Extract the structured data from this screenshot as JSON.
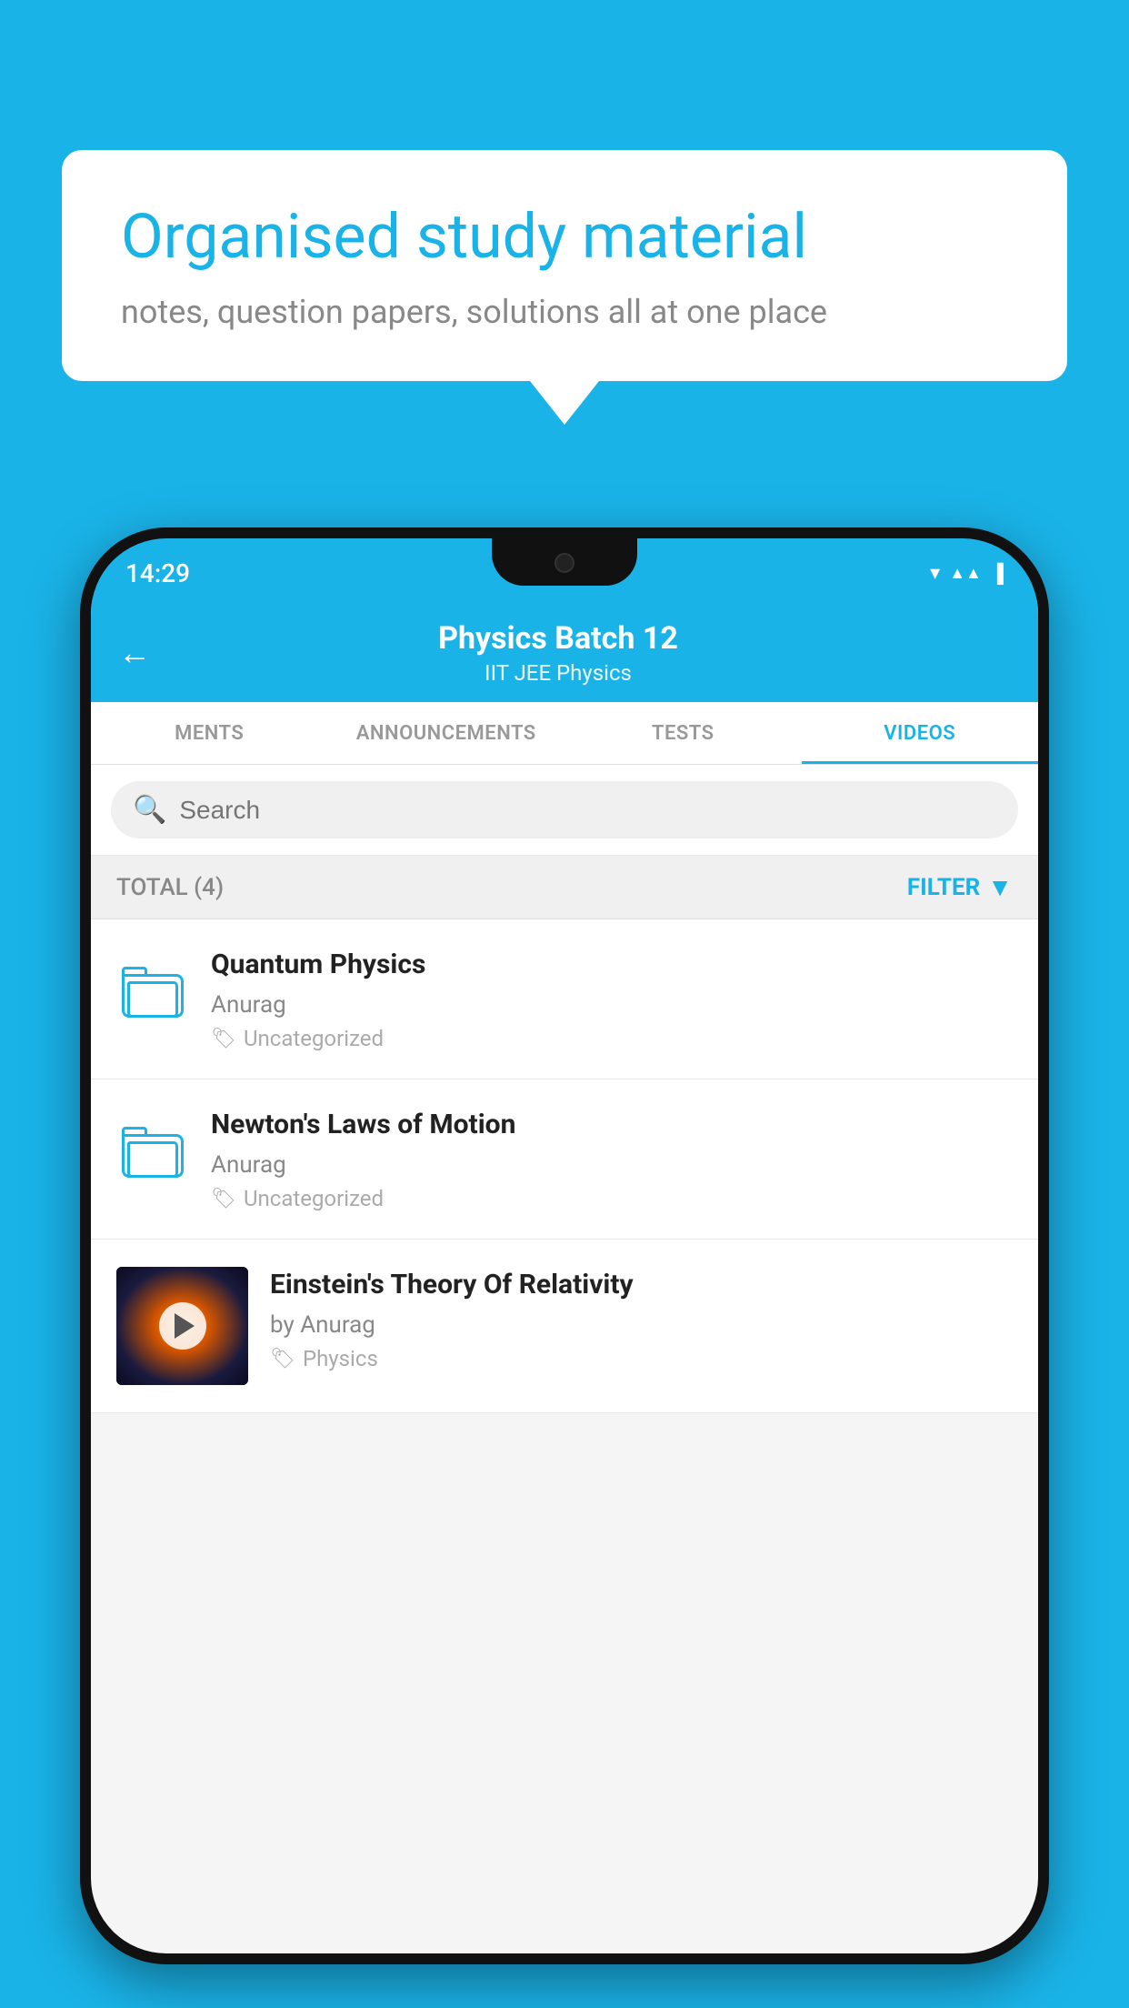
{
  "background_color": "#1ab3e8",
  "speech_bubble": {
    "title": "Organised study material",
    "subtitle": "notes, question papers, solutions all at one place"
  },
  "status_bar": {
    "time": "14:29",
    "icons": [
      "wifi",
      "signal",
      "battery"
    ]
  },
  "header": {
    "title": "Physics Batch 12",
    "subtitle": "IIT JEE   Physics",
    "back_label": "←"
  },
  "tabs": [
    {
      "label": "MENTS",
      "active": false
    },
    {
      "label": "ANNOUNCEMENTS",
      "active": false
    },
    {
      "label": "TESTS",
      "active": false
    },
    {
      "label": "VIDEOS",
      "active": true
    }
  ],
  "search": {
    "placeholder": "Search"
  },
  "filter_row": {
    "total_label": "TOTAL (4)",
    "filter_label": "FILTER"
  },
  "videos": [
    {
      "id": 1,
      "title": "Quantum Physics",
      "author": "Anurag",
      "tag": "Uncategorized",
      "has_thumbnail": false
    },
    {
      "id": 2,
      "title": "Newton's Laws of Motion",
      "author": "Anurag",
      "tag": "Uncategorized",
      "has_thumbnail": false
    },
    {
      "id": 3,
      "title": "Einstein's Theory Of Relativity",
      "author": "by Anurag",
      "tag": "Physics",
      "has_thumbnail": true
    }
  ]
}
